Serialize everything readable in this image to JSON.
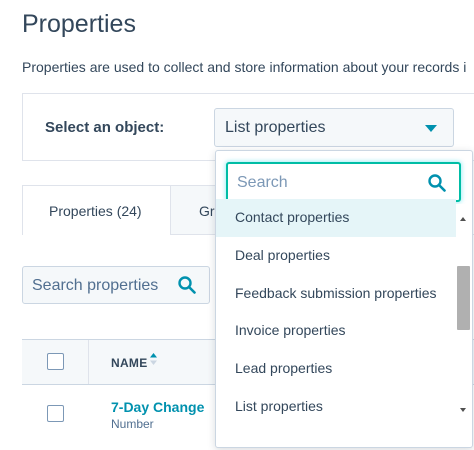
{
  "page": {
    "title": "Properties",
    "description": "Properties are used to collect and store information about your records i"
  },
  "object_selector": {
    "label": "Select an object:",
    "value": "List properties"
  },
  "tabs": [
    {
      "label": "Properties (24)",
      "active": true
    },
    {
      "label": "Gro",
      "active": false
    }
  ],
  "search": {
    "placeholder": "Search properties",
    "icon": "search-icon"
  },
  "table": {
    "columns": [
      "NAME"
    ],
    "rows": [
      {
        "name": "7-Day Change",
        "type": "Number"
      }
    ]
  },
  "dropdown": {
    "search_placeholder": "Search",
    "options": [
      "Contact properties",
      "Deal properties",
      "Feedback submission properties",
      "Invoice properties",
      "Lead properties",
      "List properties"
    ],
    "highlighted_index": 0
  },
  "colors": {
    "accent": "#0091ae",
    "text": "#33475b",
    "focus_border": "#00bda5",
    "highlight": "#e5f5f8"
  }
}
